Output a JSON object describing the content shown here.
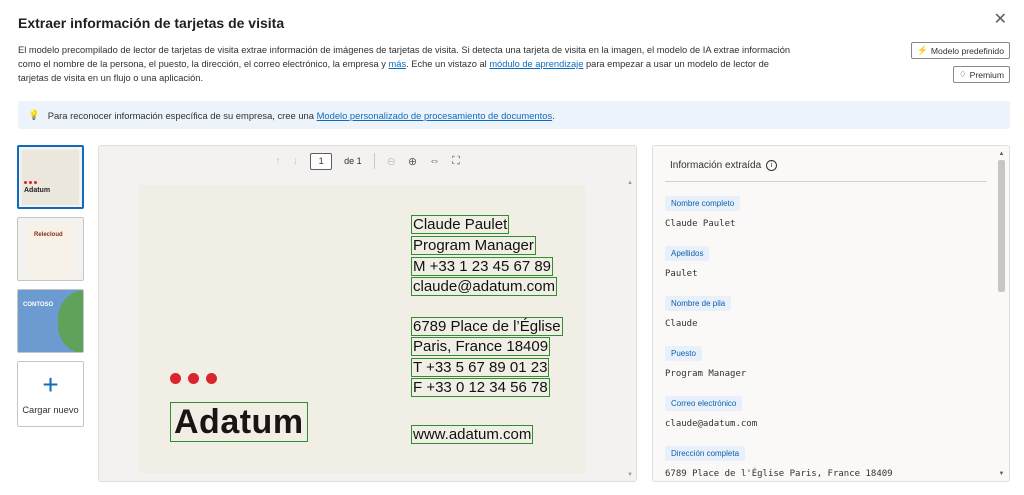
{
  "header": {
    "title": "Extraer información de tarjetas de visita",
    "close_icon": "close-icon"
  },
  "description": {
    "part1": "El modelo precompilado de lector de tarjetas de visita extrae información de imágenes de tarjetas de visita. Si detecta una tarjeta de visita en la imagen, el modelo de IA extrae información como el nombre de la persona, el puesto, la dirección, el correo electrónico, la empresa y ",
    "link1": "más",
    "part2": ". Eche un vistazo al ",
    "link2": "módulo de aprendizaje",
    "part3": " para empezar a usar un modelo de lector de tarjetas de visita en un flujo o una aplicación."
  },
  "chips": {
    "model_label": "Modelo predefinido",
    "premium_label": "Premium"
  },
  "info_bar": {
    "text": "Para reconocer información específica de su empresa, cree una ",
    "link": "Modelo personalizado de procesamiento de documentos",
    "suffix": "."
  },
  "thumbnails": [
    {
      "name": "Adatum"
    },
    {
      "name": "Relecloud"
    },
    {
      "name": "CONTOSO"
    }
  ],
  "upload": {
    "label": "Cargar nuevo"
  },
  "viewer": {
    "page_number": "1",
    "page_of": "de 1"
  },
  "card": {
    "brand": "Adatum",
    "lines": [
      "Claude Paulet",
      "Program Manager",
      "M +33 1 23 45 67 89",
      "claude@adatum.com",
      "6789 Place de l’Église",
      "Paris, France 18409",
      "T +33 5 67 89 01 23",
      "F +33 0 12 34 56 78",
      "www.adatum.com"
    ]
  },
  "panel": {
    "title": "Información extraída",
    "fields": [
      {
        "label": "Nombre completo",
        "value": "Claude Paulet"
      },
      {
        "label": "Apellidos",
        "value": "Paulet"
      },
      {
        "label": "Nombre de pila",
        "value": "Claude"
      },
      {
        "label": "Puesto",
        "value": "Program Manager"
      },
      {
        "label": "Correo electrónico",
        "value": "claude@adatum.com"
      },
      {
        "label": "Dirección completa",
        "value": "6789 Place de l'Église Paris, France 18409"
      }
    ]
  },
  "colors": {
    "accent": "#0f6cbd",
    "box_outline": "#2f8f2f",
    "brand_red": "#d8252e"
  }
}
